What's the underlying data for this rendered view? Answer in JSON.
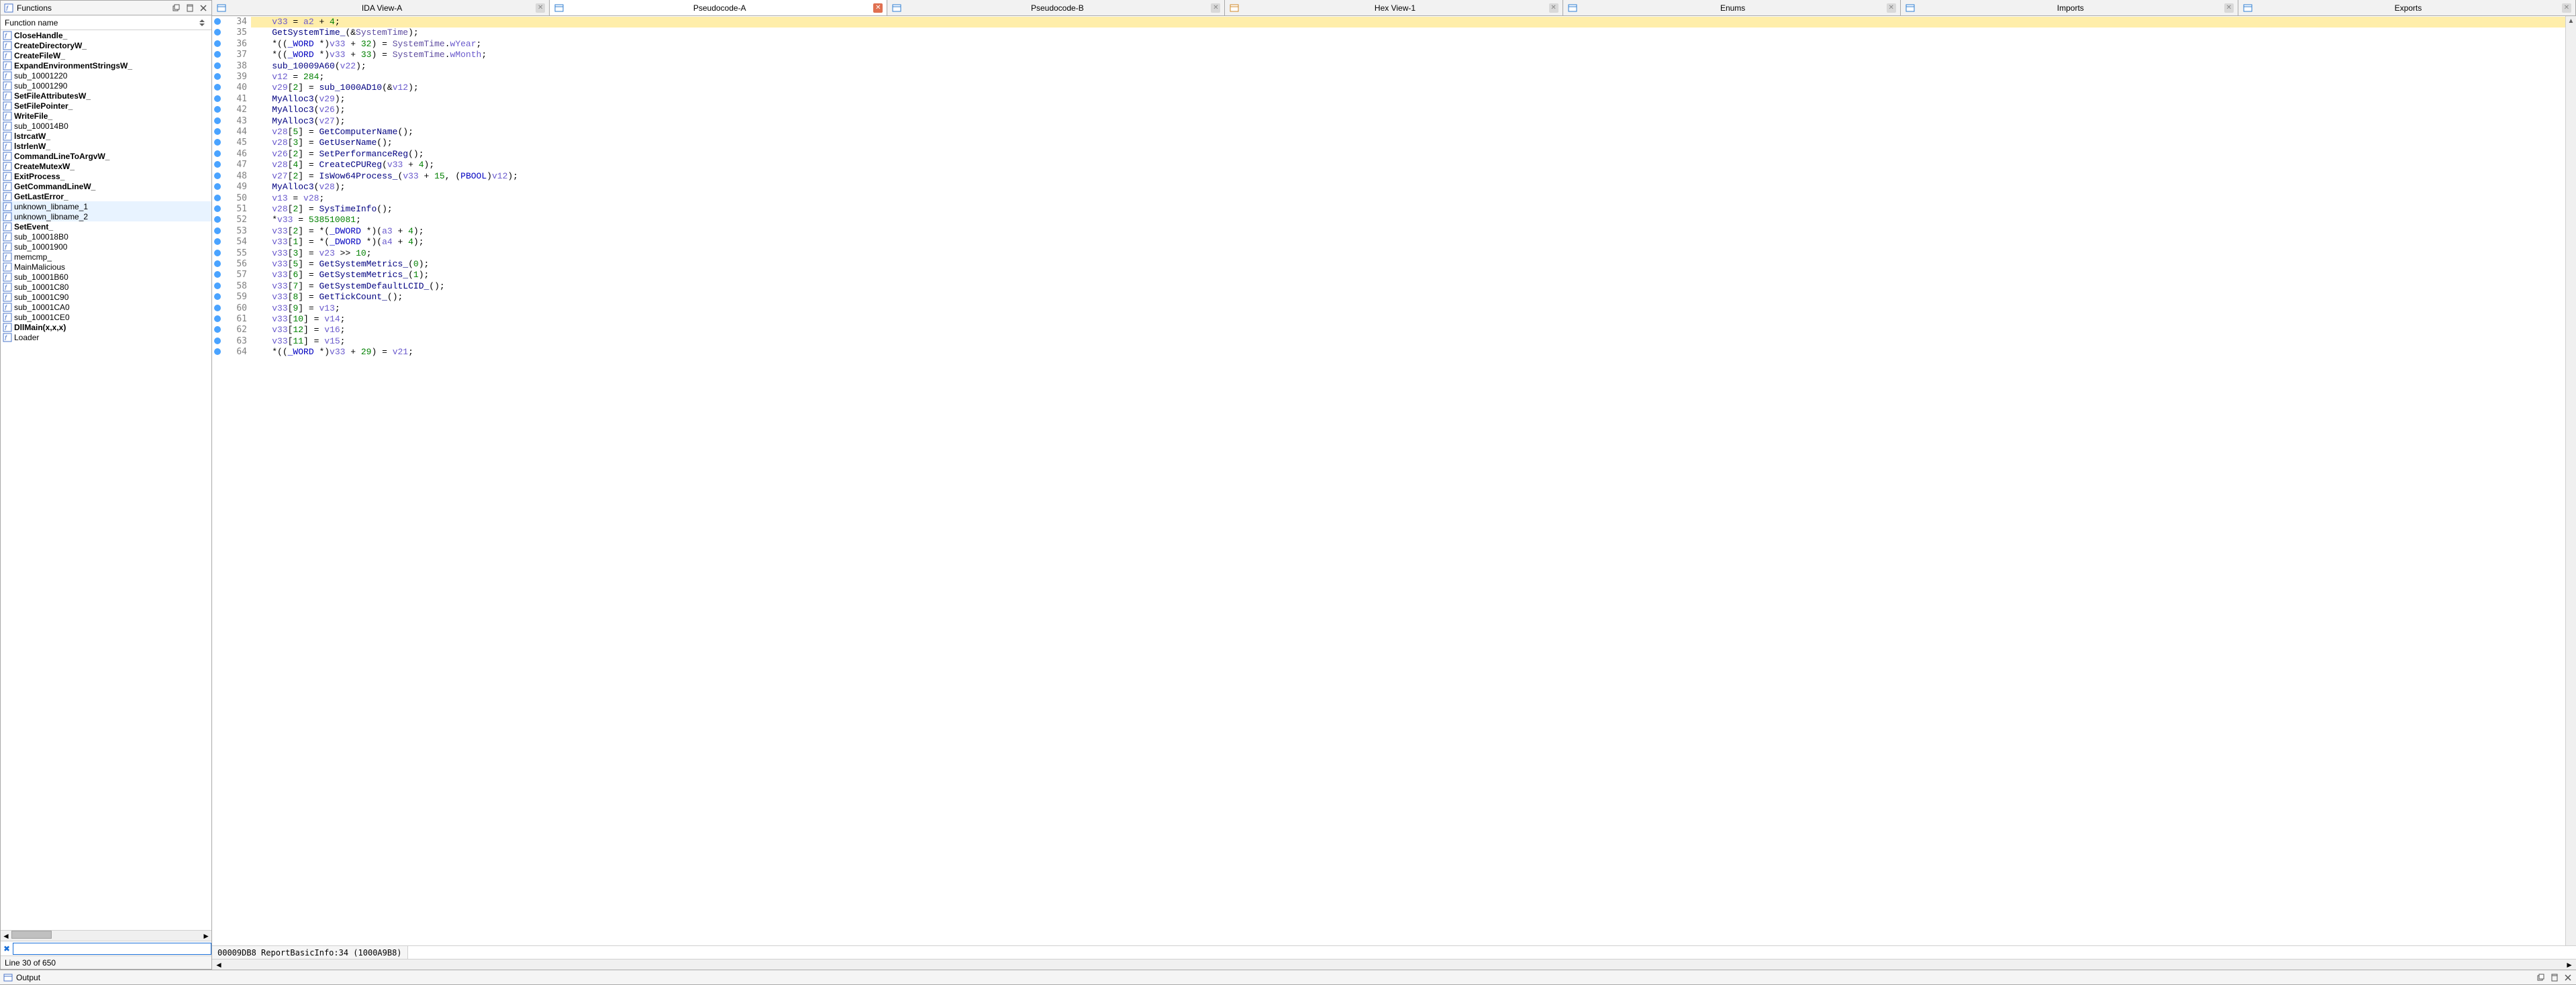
{
  "functions_panel": {
    "title": "Functions",
    "column_header": "Function name",
    "search_value": "",
    "status": "Line 30 of 650",
    "items": [
      {
        "name": "CloseHandle_",
        "bold": true
      },
      {
        "name": "CreateDirectoryW_",
        "bold": true
      },
      {
        "name": "CreateFileW_",
        "bold": true
      },
      {
        "name": "ExpandEnvironmentStringsW_",
        "bold": true
      },
      {
        "name": "sub_10001220",
        "bold": false
      },
      {
        "name": "sub_10001290",
        "bold": false
      },
      {
        "name": "SetFileAttributesW_",
        "bold": true
      },
      {
        "name": "SetFilePointer_",
        "bold": true
      },
      {
        "name": "WriteFile_",
        "bold": true
      },
      {
        "name": "sub_100014B0",
        "bold": false
      },
      {
        "name": "lstrcatW_",
        "bold": true
      },
      {
        "name": "lstrlenW_",
        "bold": true
      },
      {
        "name": "CommandLineToArgvW_",
        "bold": true
      },
      {
        "name": "CreateMutexW_",
        "bold": true
      },
      {
        "name": "ExitProcess_",
        "bold": true
      },
      {
        "name": "GetCommandLineW_",
        "bold": true
      },
      {
        "name": "GetLastError_",
        "bold": true
      },
      {
        "name": "unknown_libname_1",
        "bold": false,
        "sel": true
      },
      {
        "name": "unknown_libname_2",
        "bold": false,
        "sel": true
      },
      {
        "name": "SetEvent_",
        "bold": true
      },
      {
        "name": "sub_100018B0",
        "bold": false
      },
      {
        "name": "sub_10001900",
        "bold": false
      },
      {
        "name": "memcmp_",
        "bold": false
      },
      {
        "name": "MainMalicious",
        "bold": false
      },
      {
        "name": "sub_10001B60",
        "bold": false
      },
      {
        "name": "sub_10001C80",
        "bold": false
      },
      {
        "name": "sub_10001C90",
        "bold": false
      },
      {
        "name": "sub_10001CA0",
        "bold": false
      },
      {
        "name": "sub_10001CE0",
        "bold": false
      },
      {
        "name": "DllMain(x,x,x)",
        "bold": true
      },
      {
        "name": "Loader",
        "bold": false
      }
    ]
  },
  "tabs": [
    {
      "label": "IDA View-A",
      "icon": "ida",
      "active": false
    },
    {
      "label": "Pseudocode-A",
      "icon": "pc",
      "active": true
    },
    {
      "label": "Pseudocode-B",
      "icon": "pc",
      "active": false
    },
    {
      "label": "Hex View-1",
      "icon": "hex",
      "active": false
    },
    {
      "label": "Enums",
      "icon": "enum",
      "active": false
    },
    {
      "label": "Imports",
      "icon": "imp",
      "active": false
    },
    {
      "label": "Exports",
      "icon": "exp",
      "active": false
    }
  ],
  "code": {
    "first_line_no": 34,
    "highlight_line": 34,
    "status": "00009DB8 ReportBasicInfo:34 (1000A9B8)",
    "lines": [
      [
        [
          "var",
          "v33"
        ],
        [
          "op",
          " = "
        ],
        [
          "var",
          "a2"
        ],
        [
          "op",
          " + "
        ],
        [
          "num",
          "4"
        ],
        [
          "op",
          ";"
        ]
      ],
      [
        [
          "call",
          "GetSystemTime_"
        ],
        [
          "op",
          "(&"
        ],
        [
          "glb",
          "SystemTime"
        ],
        [
          "op",
          ");"
        ]
      ],
      [
        [
          "op",
          "*(("
        ],
        [
          "kw",
          "_WORD"
        ],
        [
          "op",
          " *)"
        ],
        [
          "var",
          "v33"
        ],
        [
          "op",
          " + "
        ],
        [
          "num",
          "32"
        ],
        [
          "op",
          ") = "
        ],
        [
          "glb",
          "SystemTime"
        ],
        [
          "op",
          "."
        ],
        [
          "fld",
          "wYear"
        ],
        [
          "op",
          ";"
        ]
      ],
      [
        [
          "op",
          "*(("
        ],
        [
          "kw",
          "_WORD"
        ],
        [
          "op",
          " *)"
        ],
        [
          "var",
          "v33"
        ],
        [
          "op",
          " + "
        ],
        [
          "num",
          "33"
        ],
        [
          "op",
          ") = "
        ],
        [
          "glb",
          "SystemTime"
        ],
        [
          "op",
          "."
        ],
        [
          "fld",
          "wMonth"
        ],
        [
          "op",
          ";"
        ]
      ],
      [
        [
          "call",
          "sub_10009A60"
        ],
        [
          "op",
          "("
        ],
        [
          "var",
          "v22"
        ],
        [
          "op",
          ");"
        ]
      ],
      [
        [
          "var",
          "v12"
        ],
        [
          "op",
          " = "
        ],
        [
          "num",
          "284"
        ],
        [
          "op",
          ";"
        ]
      ],
      [
        [
          "var",
          "v29"
        ],
        [
          "op",
          "["
        ],
        [
          "num",
          "2"
        ],
        [
          "op",
          "] = "
        ],
        [
          "call",
          "sub_1000AD10"
        ],
        [
          "op",
          "(&"
        ],
        [
          "var",
          "v12"
        ],
        [
          "op",
          ");"
        ]
      ],
      [
        [
          "call",
          "MyAlloc3"
        ],
        [
          "op",
          "("
        ],
        [
          "var",
          "v29"
        ],
        [
          "op",
          ");"
        ]
      ],
      [
        [
          "call",
          "MyAlloc3"
        ],
        [
          "op",
          "("
        ],
        [
          "var",
          "v26"
        ],
        [
          "op",
          ");"
        ]
      ],
      [
        [
          "call",
          "MyAlloc3"
        ],
        [
          "op",
          "("
        ],
        [
          "var",
          "v27"
        ],
        [
          "op",
          ");"
        ]
      ],
      [
        [
          "var",
          "v28"
        ],
        [
          "op",
          "["
        ],
        [
          "num",
          "5"
        ],
        [
          "op",
          "] = "
        ],
        [
          "call",
          "GetComputerName"
        ],
        [
          "op",
          "();"
        ]
      ],
      [
        [
          "var",
          "v28"
        ],
        [
          "op",
          "["
        ],
        [
          "num",
          "3"
        ],
        [
          "op",
          "] = "
        ],
        [
          "call",
          "GetUserName"
        ],
        [
          "op",
          "();"
        ]
      ],
      [
        [
          "var",
          "v26"
        ],
        [
          "op",
          "["
        ],
        [
          "num",
          "2"
        ],
        [
          "op",
          "] = "
        ],
        [
          "call",
          "SetPerformanceReg"
        ],
        [
          "op",
          "();"
        ]
      ],
      [
        [
          "var",
          "v28"
        ],
        [
          "op",
          "["
        ],
        [
          "num",
          "4"
        ],
        [
          "op",
          "] = "
        ],
        [
          "call",
          "CreateCPUReg"
        ],
        [
          "op",
          "("
        ],
        [
          "var",
          "v33"
        ],
        [
          "op",
          " + "
        ],
        [
          "num",
          "4"
        ],
        [
          "op",
          ");"
        ]
      ],
      [
        [
          "var",
          "v27"
        ],
        [
          "op",
          "["
        ],
        [
          "num",
          "2"
        ],
        [
          "op",
          "] = "
        ],
        [
          "call",
          "IsWow64Process_"
        ],
        [
          "op",
          "("
        ],
        [
          "var",
          "v33"
        ],
        [
          "op",
          " + "
        ],
        [
          "num",
          "15"
        ],
        [
          "op",
          ", ("
        ],
        [
          "kw",
          "PBOOL"
        ],
        [
          "op",
          ")"
        ],
        [
          "var",
          "v12"
        ],
        [
          "op",
          ");"
        ]
      ],
      [
        [
          "call",
          "MyAlloc3"
        ],
        [
          "op",
          "("
        ],
        [
          "var",
          "v28"
        ],
        [
          "op",
          ");"
        ]
      ],
      [
        [
          "var",
          "v13"
        ],
        [
          "op",
          " = "
        ],
        [
          "var",
          "v28"
        ],
        [
          "op",
          ";"
        ]
      ],
      [
        [
          "var",
          "v28"
        ],
        [
          "op",
          "["
        ],
        [
          "num",
          "2"
        ],
        [
          "op",
          "] = "
        ],
        [
          "call",
          "SysTimeInfo"
        ],
        [
          "op",
          "();"
        ]
      ],
      [
        [
          "op",
          "*"
        ],
        [
          "var",
          "v33"
        ],
        [
          "op",
          " = "
        ],
        [
          "num",
          "538510081"
        ],
        [
          "op",
          ";"
        ]
      ],
      [
        [
          "var",
          "v33"
        ],
        [
          "op",
          "["
        ],
        [
          "num",
          "2"
        ],
        [
          "op",
          "] = *("
        ],
        [
          "kw",
          "_DWORD"
        ],
        [
          "op",
          " *)("
        ],
        [
          "var",
          "a3"
        ],
        [
          "op",
          " + "
        ],
        [
          "num",
          "4"
        ],
        [
          "op",
          ");"
        ]
      ],
      [
        [
          "var",
          "v33"
        ],
        [
          "op",
          "["
        ],
        [
          "num",
          "1"
        ],
        [
          "op",
          "] = *("
        ],
        [
          "kw",
          "_DWORD"
        ],
        [
          "op",
          " *)("
        ],
        [
          "var",
          "a4"
        ],
        [
          "op",
          " + "
        ],
        [
          "num",
          "4"
        ],
        [
          "op",
          ");"
        ]
      ],
      [
        [
          "var",
          "v33"
        ],
        [
          "op",
          "["
        ],
        [
          "num",
          "3"
        ],
        [
          "op",
          "] = "
        ],
        [
          "var",
          "v23"
        ],
        [
          "op",
          " >> "
        ],
        [
          "num",
          "10"
        ],
        [
          "op",
          ";"
        ]
      ],
      [
        [
          "var",
          "v33"
        ],
        [
          "op",
          "["
        ],
        [
          "num",
          "5"
        ],
        [
          "op",
          "] = "
        ],
        [
          "call",
          "GetSystemMetrics_"
        ],
        [
          "op",
          "("
        ],
        [
          "num",
          "0"
        ],
        [
          "op",
          ");"
        ]
      ],
      [
        [
          "var",
          "v33"
        ],
        [
          "op",
          "["
        ],
        [
          "num",
          "6"
        ],
        [
          "op",
          "] = "
        ],
        [
          "call",
          "GetSystemMetrics_"
        ],
        [
          "op",
          "("
        ],
        [
          "num",
          "1"
        ],
        [
          "op",
          ");"
        ]
      ],
      [
        [
          "var",
          "v33"
        ],
        [
          "op",
          "["
        ],
        [
          "num",
          "7"
        ],
        [
          "op",
          "] = "
        ],
        [
          "call",
          "GetSystemDefaultLCID_"
        ],
        [
          "op",
          "();"
        ]
      ],
      [
        [
          "var",
          "v33"
        ],
        [
          "op",
          "["
        ],
        [
          "num",
          "8"
        ],
        [
          "op",
          "] = "
        ],
        [
          "call",
          "GetTickCount_"
        ],
        [
          "op",
          "();"
        ]
      ],
      [
        [
          "var",
          "v33"
        ],
        [
          "op",
          "["
        ],
        [
          "num",
          "9"
        ],
        [
          "op",
          "] = "
        ],
        [
          "var",
          "v13"
        ],
        [
          "op",
          ";"
        ]
      ],
      [
        [
          "var",
          "v33"
        ],
        [
          "op",
          "["
        ],
        [
          "num",
          "10"
        ],
        [
          "op",
          "] = "
        ],
        [
          "var",
          "v14"
        ],
        [
          "op",
          ";"
        ]
      ],
      [
        [
          "var",
          "v33"
        ],
        [
          "op",
          "["
        ],
        [
          "num",
          "12"
        ],
        [
          "op",
          "] = "
        ],
        [
          "var",
          "v16"
        ],
        [
          "op",
          ";"
        ]
      ],
      [
        [
          "var",
          "v33"
        ],
        [
          "op",
          "["
        ],
        [
          "num",
          "11"
        ],
        [
          "op",
          "] = "
        ],
        [
          "var",
          "v15"
        ],
        [
          "op",
          ";"
        ]
      ],
      [
        [
          "op",
          "*(("
        ],
        [
          "kw",
          "_WORD"
        ],
        [
          "op",
          " *)"
        ],
        [
          "var",
          "v33"
        ],
        [
          "op",
          " + "
        ],
        [
          "num",
          "29"
        ],
        [
          "op",
          ") = "
        ],
        [
          "var",
          "v21"
        ],
        [
          "op",
          ";"
        ]
      ]
    ]
  },
  "output_panel": {
    "title": "Output"
  }
}
